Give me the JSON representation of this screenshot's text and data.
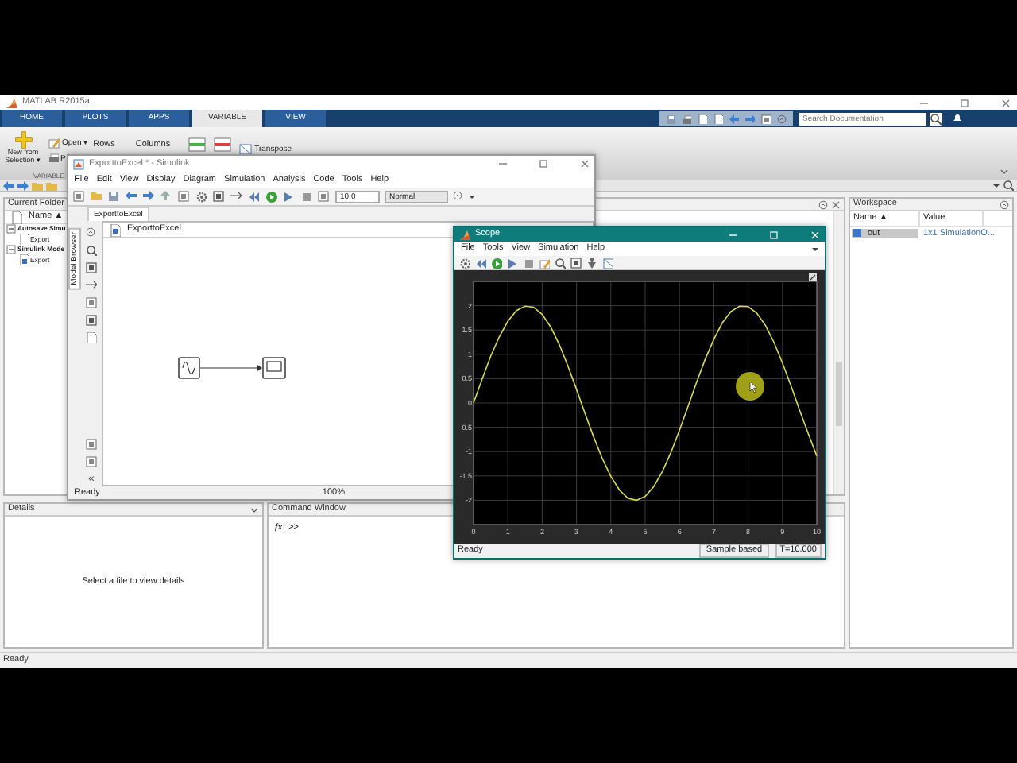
{
  "window": {
    "title": "MATLAB R2015a"
  },
  "ribbon_tabs": [
    {
      "label": "HOME",
      "selected": false
    },
    {
      "label": "PLOTS",
      "selected": false
    },
    {
      "label": "APPS",
      "selected": false
    },
    {
      "label": "VARIABLE",
      "selected": true
    },
    {
      "label": "VIEW",
      "selected": false
    }
  ],
  "search": {
    "placeholder": "Search Documentation"
  },
  "ribbon": {
    "new_from_selection": "New from Selection ▾",
    "open": "Open ▾",
    "print": "P",
    "rows": "Rows",
    "columns": "Columns",
    "transpose": "Transpose",
    "section_label": "VARIABLE"
  },
  "current_folder": {
    "title": "Current Folder",
    "column": "Name ▲",
    "items": [
      {
        "label": "Autosave Simu",
        "expanded": true,
        "children": [
          {
            "label": "Export"
          }
        ]
      },
      {
        "label": "Simulink Mode",
        "expanded": true,
        "children": [
          {
            "label": "Export"
          }
        ]
      }
    ]
  },
  "details": {
    "title": "Details",
    "message": "Select a file to view details"
  },
  "command_window": {
    "title": "Command Window",
    "fx": "fx",
    "prompt": ">>"
  },
  "workspace": {
    "title": "Workspace",
    "columns": [
      "Name ▲",
      "Value"
    ],
    "rows": [
      {
        "name": "out",
        "value": "1x1 SimulationO...",
        "selected": true
      }
    ]
  },
  "status_bar": "Ready",
  "simulink": {
    "title": "ExporttoExcel * - Simulink",
    "menu": [
      "File",
      "Edit",
      "View",
      "Display",
      "Diagram",
      "Simulation",
      "Analysis",
      "Code",
      "Tools",
      "Help"
    ],
    "stop_time": "10.0",
    "mode": "Normal",
    "tab": "ExporttoExcel",
    "breadcrumb": "ExporttoExcel",
    "side_tab": "Model Browser",
    "collapse": "«",
    "status": "Ready",
    "zoom": "100%"
  },
  "scope": {
    "title": "Scope",
    "menu": [
      "File",
      "Tools",
      "View",
      "Simulation",
      "Help"
    ],
    "status": "Ready",
    "mode": "Sample based",
    "time": "T=10.000",
    "chart_data": {
      "type": "line",
      "x": [
        0,
        0.25,
        0.5,
        0.75,
        1,
        1.25,
        1.5,
        1.75,
        2,
        2.25,
        2.5,
        2.75,
        3,
        3.25,
        3.5,
        3.75,
        4,
        4.25,
        4.5,
        4.75,
        5,
        5.25,
        5.5,
        5.75,
        6,
        6.25,
        6.5,
        6.75,
        7,
        7.25,
        7.5,
        7.75,
        8,
        8.25,
        8.5,
        8.75,
        9,
        9.25,
        9.5,
        9.75,
        10
      ],
      "values": [
        0,
        0.49,
        0.96,
        1.36,
        1.68,
        1.9,
        1.99,
        1.97,
        1.82,
        1.56,
        1.2,
        0.76,
        0.28,
        -0.22,
        -0.7,
        -1.14,
        -1.51,
        -1.79,
        -1.96,
        -2,
        -1.92,
        -1.72,
        -1.41,
        -1.02,
        -0.56,
        -0.07,
        0.43,
        0.9,
        1.31,
        1.65,
        1.88,
        1.99,
        1.98,
        1.85,
        1.6,
        1.25,
        0.82,
        0.35,
        -0.15,
        -0.63,
        -1.09
      ],
      "xlim": [
        0,
        10
      ],
      "ylim": [
        -2.5,
        2.5
      ],
      "xticks": [
        0,
        1,
        2,
        3,
        4,
        5,
        6,
        7,
        8,
        9,
        10
      ],
      "yticks": [
        -2,
        -1.5,
        -1,
        -0.5,
        0,
        0.5,
        1,
        1.5,
        2
      ],
      "grid": true
    }
  }
}
